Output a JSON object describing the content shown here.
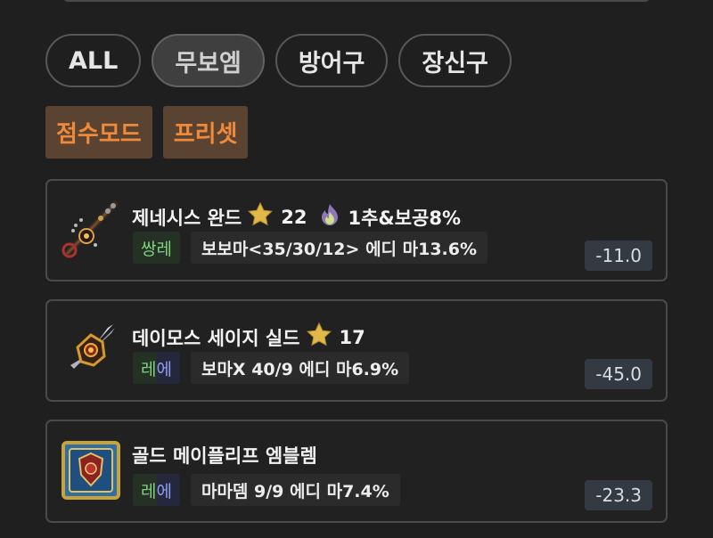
{
  "filters": [
    "ALL",
    "무보엠",
    "방어구",
    "장신구"
  ],
  "active_filter_index": 1,
  "modes": [
    "점수모드",
    "프리셋"
  ],
  "items": [
    {
      "name": "제네시스 완드",
      "star_icon": "star-icon",
      "stars": "22",
      "flame_icon": "flame-icon",
      "flame_text": "1추&보공8%",
      "rank_label_a": "쌍레",
      "rank_label_b": "",
      "rank_style": "ssang",
      "option_text": "보보마<35/30/12> 에디 마13.6%",
      "score": "-11.0"
    },
    {
      "name": "데이모스 세이지 실드",
      "star_icon": "star-icon",
      "stars": "17",
      "rank_label_a": "레",
      "rank_label_b": "에",
      "rank_style": "re",
      "option_text": "보마X 40/9 에디 마6.9%",
      "score": "-45.0"
    },
    {
      "name": "골드 메이플리프 엠블렘",
      "rank_label_a": "레",
      "rank_label_b": "에",
      "rank_style": "re",
      "option_text": "마마뎀 9/9 에디 마7.4%",
      "score": "-23.3"
    }
  ],
  "colors": {
    "background": "#1f1f1f",
    "mode_button_bg": "#5a4330",
    "mode_button_text": "#f08a3a",
    "rare_green": "#7fd37f",
    "rare_blue": "#8f9cf0",
    "star": "#e2b84a"
  }
}
